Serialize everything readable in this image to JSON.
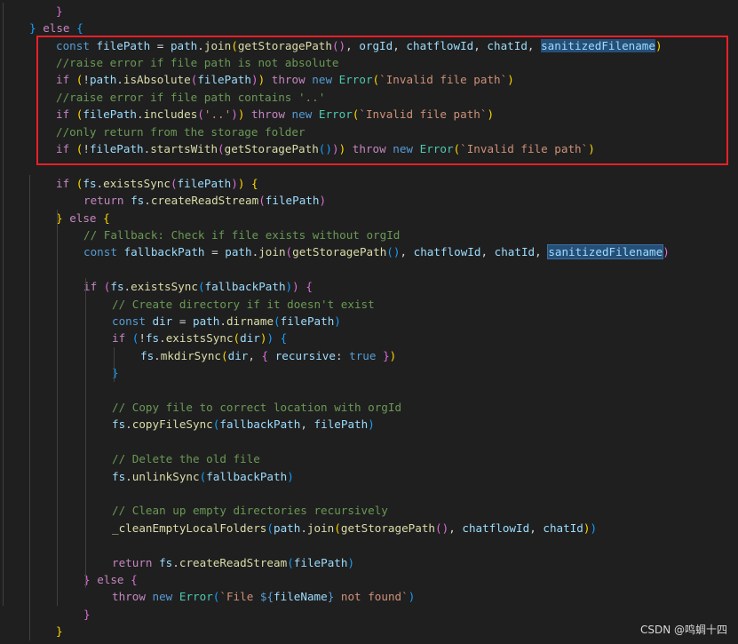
{
  "watermark": "CSDN @鸣蜩十四",
  "highlight_color": "#e8202a",
  "colors": {
    "background": "#1f1f1f",
    "keyword": "#569cd6",
    "control": "#c586c0",
    "variable": "#9cdcfe",
    "function": "#dcdcaa",
    "class": "#4ec9b0",
    "string": "#ce9178",
    "comment": "#6a9955"
  },
  "code_lines": [
    [
      [
        "}",
        "b2"
      ]
    ],
    [
      [
        "}",
        "b3"
      ],
      [
        " "
      ],
      [
        "else",
        "ctl"
      ],
      [
        " "
      ],
      [
        "{",
        "b3"
      ]
    ],
    [
      [
        "const",
        "kw"
      ],
      [
        " "
      ],
      [
        "filePath",
        "var"
      ],
      [
        " = "
      ],
      [
        "path",
        "var"
      ],
      [
        "."
      ],
      [
        "join",
        "fn"
      ],
      [
        "(",
        "b1"
      ],
      [
        "getStoragePath",
        "fn"
      ],
      [
        "()",
        "b2"
      ],
      [
        ", "
      ],
      [
        "orgId",
        "var"
      ],
      [
        ", "
      ],
      [
        "chatflowId",
        "var"
      ],
      [
        ", "
      ],
      [
        "chatId",
        "var"
      ],
      [
        ", "
      ],
      [
        "sanitizedFilename",
        "var sel"
      ],
      [
        ")",
        "b1"
      ]
    ],
    [
      [
        "//raise error if file path is not absolute",
        "cmt"
      ]
    ],
    [
      [
        "if",
        "ctl"
      ],
      [
        " "
      ],
      [
        "(",
        "b1"
      ],
      [
        "!"
      ],
      [
        "path",
        "var"
      ],
      [
        "."
      ],
      [
        "isAbsolute",
        "fn"
      ],
      [
        "(",
        "b2"
      ],
      [
        "filePath",
        "var"
      ],
      [
        ")",
        "b2"
      ],
      [
        ")",
        "b1"
      ],
      [
        " "
      ],
      [
        "throw",
        "ctl"
      ],
      [
        " "
      ],
      [
        "new",
        "kw"
      ],
      [
        " "
      ],
      [
        "Error",
        "cls"
      ],
      [
        "(",
        "b1"
      ],
      [
        "`Invalid file path`",
        "str"
      ],
      [
        ")",
        "b1"
      ]
    ],
    [
      [
        "//raise error if file path contains '..'",
        "cmt"
      ]
    ],
    [
      [
        "if",
        "ctl"
      ],
      [
        " "
      ],
      [
        "(",
        "b1"
      ],
      [
        "filePath",
        "var"
      ],
      [
        "."
      ],
      [
        "includes",
        "fn"
      ],
      [
        "(",
        "b2"
      ],
      [
        "'..'",
        "str"
      ],
      [
        ")",
        "b2"
      ],
      [
        ")",
        "b1"
      ],
      [
        " "
      ],
      [
        "throw",
        "ctl"
      ],
      [
        " "
      ],
      [
        "new",
        "kw"
      ],
      [
        " "
      ],
      [
        "Error",
        "cls"
      ],
      [
        "(",
        "b1"
      ],
      [
        "`Invalid file path`",
        "str"
      ],
      [
        ")",
        "b1"
      ]
    ],
    [
      [
        "//only return from the storage folder",
        "cmt"
      ]
    ],
    [
      [
        "if",
        "ctl"
      ],
      [
        " "
      ],
      [
        "(",
        "b1"
      ],
      [
        "!"
      ],
      [
        "filePath",
        "var"
      ],
      [
        "."
      ],
      [
        "startsWith",
        "fn"
      ],
      [
        "(",
        "b2"
      ],
      [
        "getStoragePath",
        "fn"
      ],
      [
        "()",
        "b3"
      ],
      [
        ")",
        "b2"
      ],
      [
        ")",
        "b1"
      ],
      [
        " "
      ],
      [
        "throw",
        "ctl"
      ],
      [
        " "
      ],
      [
        "new",
        "kw"
      ],
      [
        " "
      ],
      [
        "Error",
        "cls"
      ],
      [
        "(",
        "b1"
      ],
      [
        "`Invalid file path`",
        "str"
      ],
      [
        ")",
        "b1"
      ]
    ],
    [],
    [
      [
        "if",
        "ctl"
      ],
      [
        " "
      ],
      [
        "(",
        "b1"
      ],
      [
        "fs",
        "var"
      ],
      [
        "."
      ],
      [
        "existsSync",
        "fn"
      ],
      [
        "(",
        "b2"
      ],
      [
        "filePath",
        "var"
      ],
      [
        ")",
        "b2"
      ],
      [
        ")",
        "b1"
      ],
      [
        " "
      ],
      [
        "{",
        "b1"
      ]
    ],
    [
      [
        "return",
        "ctl"
      ],
      [
        " "
      ],
      [
        "fs",
        "var"
      ],
      [
        "."
      ],
      [
        "createReadStream",
        "fn"
      ],
      [
        "(",
        "b2"
      ],
      [
        "filePath",
        "var"
      ],
      [
        ")",
        "b2"
      ]
    ],
    [
      [
        "}",
        "b1"
      ],
      [
        " "
      ],
      [
        "else",
        "ctl"
      ],
      [
        " "
      ],
      [
        "{",
        "b1"
      ]
    ],
    [
      [
        "// Fallback: Check if file exists without orgId",
        "cmt"
      ]
    ],
    [
      [
        "const",
        "kw"
      ],
      [
        " "
      ],
      [
        "fallbackPath",
        "var"
      ],
      [
        " = "
      ],
      [
        "path",
        "var"
      ],
      [
        "."
      ],
      [
        "join",
        "fn"
      ],
      [
        "(",
        "b2"
      ],
      [
        "getStoragePath",
        "fn"
      ],
      [
        "()",
        "b3"
      ],
      [
        ", "
      ],
      [
        "chatflowId",
        "var"
      ],
      [
        ", "
      ],
      [
        "chatId",
        "var"
      ],
      [
        ", "
      ],
      [
        "sanitizedFilename",
        "var sel sel-box"
      ],
      [
        ")",
        "b2"
      ]
    ],
    [],
    [
      [
        "if",
        "ctl"
      ],
      [
        " "
      ],
      [
        "(",
        "b2"
      ],
      [
        "fs",
        "var"
      ],
      [
        "."
      ],
      [
        "existsSync",
        "fn"
      ],
      [
        "(",
        "b3"
      ],
      [
        "fallbackPath",
        "var"
      ],
      [
        ")",
        "b3"
      ],
      [
        ")",
        "b2"
      ],
      [
        " "
      ],
      [
        "{",
        "b2"
      ]
    ],
    [
      [
        "// Create directory if it doesn't exist",
        "cmt"
      ]
    ],
    [
      [
        "const",
        "kw"
      ],
      [
        " "
      ],
      [
        "dir",
        "var"
      ],
      [
        " = "
      ],
      [
        "path",
        "var"
      ],
      [
        "."
      ],
      [
        "dirname",
        "fn"
      ],
      [
        "(",
        "b3"
      ],
      [
        "filePath",
        "var"
      ],
      [
        ")",
        "b3"
      ]
    ],
    [
      [
        "if",
        "ctl"
      ],
      [
        " "
      ],
      [
        "(",
        "b3"
      ],
      [
        "!"
      ],
      [
        "fs",
        "var"
      ],
      [
        "."
      ],
      [
        "existsSync",
        "fn"
      ],
      [
        "(",
        "b1"
      ],
      [
        "dir",
        "var"
      ],
      [
        ")",
        "b1"
      ],
      [
        ")",
        "b3"
      ],
      [
        " "
      ],
      [
        "{",
        "b3"
      ]
    ],
    [
      [
        "fs",
        "var"
      ],
      [
        "."
      ],
      [
        "mkdirSync",
        "fn"
      ],
      [
        "(",
        "b1"
      ],
      [
        "dir",
        "var"
      ],
      [
        ", "
      ],
      [
        "{",
        "b2"
      ],
      [
        " "
      ],
      [
        "recursive",
        "var"
      ],
      [
        ": "
      ],
      [
        "true",
        "bool"
      ],
      [
        " "
      ],
      [
        "}",
        "b2"
      ],
      [
        ")",
        "b1"
      ]
    ],
    [
      [
        "}",
        "b3"
      ]
    ],
    [],
    [
      [
        "// Copy file to correct location with orgId",
        "cmt"
      ]
    ],
    [
      [
        "fs",
        "var"
      ],
      [
        "."
      ],
      [
        "copyFileSync",
        "fn"
      ],
      [
        "(",
        "b3"
      ],
      [
        "fallbackPath",
        "var"
      ],
      [
        ", "
      ],
      [
        "filePath",
        "var"
      ],
      [
        ")",
        "b3"
      ]
    ],
    [],
    [
      [
        "// Delete the old file",
        "cmt"
      ]
    ],
    [
      [
        "fs",
        "var"
      ],
      [
        "."
      ],
      [
        "unlinkSync",
        "fn"
      ],
      [
        "(",
        "b3"
      ],
      [
        "fallbackPath",
        "var"
      ],
      [
        ")",
        "b3"
      ]
    ],
    [],
    [
      [
        "// Clean up empty directories recursively",
        "cmt"
      ]
    ],
    [
      [
        "_cleanEmptyLocalFolders",
        "fn"
      ],
      [
        "(",
        "b3"
      ],
      [
        "path",
        "var"
      ],
      [
        "."
      ],
      [
        "join",
        "fn"
      ],
      [
        "(",
        "b1"
      ],
      [
        "getStoragePath",
        "fn"
      ],
      [
        "()",
        "b2"
      ],
      [
        ", "
      ],
      [
        "chatflowId",
        "var"
      ],
      [
        ", "
      ],
      [
        "chatId",
        "var"
      ],
      [
        ")",
        "b1"
      ],
      [
        ")",
        "b3"
      ]
    ],
    [],
    [
      [
        "return",
        "ctl"
      ],
      [
        " "
      ],
      [
        "fs",
        "var"
      ],
      [
        "."
      ],
      [
        "createReadStream",
        "fn"
      ],
      [
        "(",
        "b3"
      ],
      [
        "filePath",
        "var"
      ],
      [
        ")",
        "b3"
      ]
    ],
    [
      [
        "}",
        "b2"
      ],
      [
        " "
      ],
      [
        "else",
        "ctl"
      ],
      [
        " "
      ],
      [
        "{",
        "b2"
      ]
    ],
    [
      [
        "throw",
        "ctl"
      ],
      [
        " "
      ],
      [
        "new",
        "kw"
      ],
      [
        " "
      ],
      [
        "Error",
        "cls"
      ],
      [
        "(",
        "b3"
      ],
      [
        "`File ",
        "str"
      ],
      [
        "${",
        "tmpl"
      ],
      [
        "fileName",
        "var"
      ],
      [
        "}",
        "tmpl"
      ],
      [
        " not found`",
        "str"
      ],
      [
        ")",
        "b3"
      ]
    ],
    [
      [
        "}",
        "b2"
      ]
    ],
    [
      [
        "}",
        "b1"
      ]
    ]
  ]
}
